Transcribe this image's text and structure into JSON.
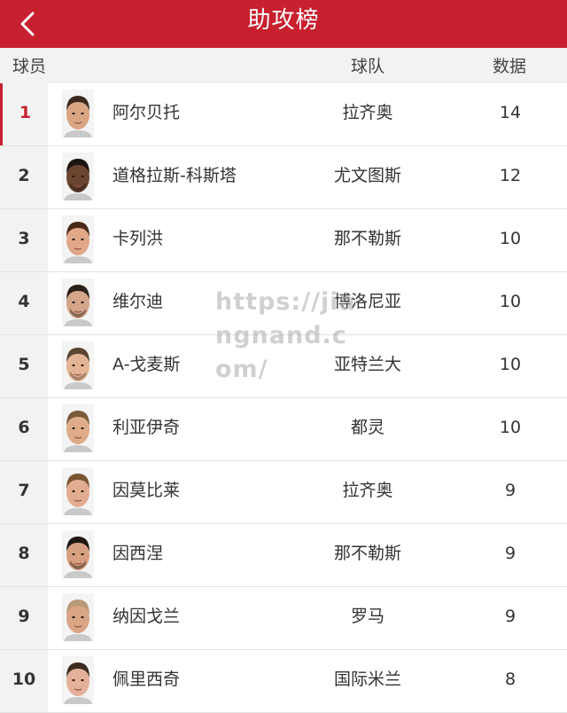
{
  "header": {
    "title": "助攻榜"
  },
  "columns": {
    "player": "球员",
    "team": "球队",
    "stat": "数据"
  },
  "watermark": "https://jiangnand.com/",
  "colors": {
    "accent": "#c8202f"
  },
  "rows": [
    {
      "rank": "1",
      "name": "阿尔贝托",
      "team": "拉齐奥",
      "value": "14",
      "hair": "#3a2a1e",
      "skin": "#d9a583",
      "beard": false
    },
    {
      "rank": "2",
      "name": "道格拉斯-科斯塔",
      "team": "尤文图斯",
      "value": "12",
      "hair": "#1b1410",
      "skin": "#6b4530",
      "beard": true
    },
    {
      "rank": "3",
      "name": "卡列洪",
      "team": "那不勒斯",
      "value": "10",
      "hair": "#4a2a18",
      "skin": "#e0a889",
      "beard": false
    },
    {
      "rank": "4",
      "name": "维尔迪",
      "team": "博洛尼亚",
      "value": "10",
      "hair": "#2b2119",
      "skin": "#d5a58a",
      "beard": true
    },
    {
      "rank": "5",
      "name": "A-戈麦斯",
      "team": "亚特兰大",
      "value": "10",
      "hair": "#5a4530",
      "skin": "#e3b596",
      "beard": true
    },
    {
      "rank": "6",
      "name": "利亚伊奇",
      "team": "都灵",
      "value": "10",
      "hair": "#7a5a38",
      "skin": "#deac8a",
      "beard": false
    },
    {
      "rank": "7",
      "name": "因莫比莱",
      "team": "拉齐奥",
      "value": "9",
      "hair": "#7b5530",
      "skin": "#e2ac90",
      "beard": false
    },
    {
      "rank": "8",
      "name": "因西涅",
      "team": "那不勒斯",
      "value": "9",
      "hair": "#1f1712",
      "skin": "#d7a080",
      "beard": true
    },
    {
      "rank": "9",
      "name": "纳因戈兰",
      "team": "罗马",
      "value": "9",
      "hair": "#b89a78",
      "skin": "#d8a585",
      "beard": false
    },
    {
      "rank": "10",
      "name": "佩里西奇",
      "team": "国际米兰",
      "value": "8",
      "hair": "#3b2a20",
      "skin": "#e3b19a",
      "beard": false
    }
  ]
}
